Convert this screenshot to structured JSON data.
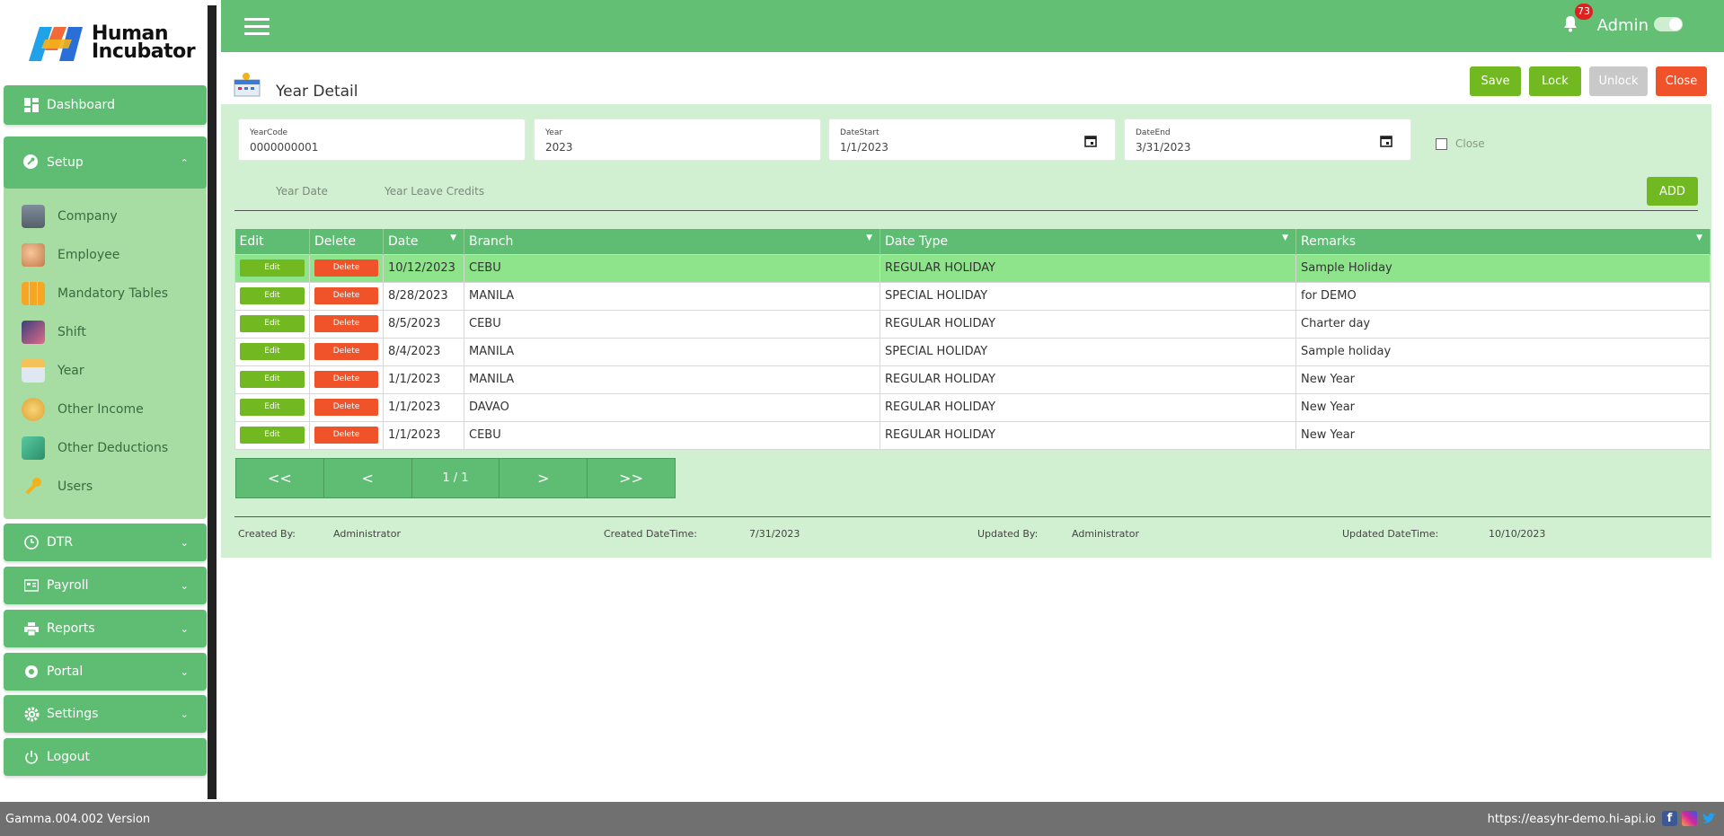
{
  "brand": {
    "name_line1": "Human",
    "name_line2": "Incubator"
  },
  "sidebar": {
    "dashboard": "Dashboard",
    "setup": "Setup",
    "setup_items": [
      "Company",
      "Employee",
      "Mandatory Tables",
      "Shift",
      "Year",
      "Other Income",
      "Other Deductions",
      "Users"
    ],
    "dtr": "DTR",
    "payroll": "Payroll",
    "reports": "Reports",
    "portal": "Portal",
    "settings": "Settings",
    "logout": "Logout"
  },
  "topbar": {
    "notification_count": "73",
    "user": "Admin"
  },
  "page": {
    "title": "Year Detail"
  },
  "actions": {
    "save": "Save",
    "lock": "Lock",
    "unlock": "Unlock",
    "close": "Close"
  },
  "form": {
    "year_code_label": "YearCode",
    "year_code": "0000000001",
    "year_label": "Year",
    "year": "2023",
    "date_start_label": "DateStart",
    "date_start": "1/1/2023",
    "date_end_label": "DateEnd",
    "date_end": "3/31/2023",
    "close_label": "Close"
  },
  "tabs": {
    "year_date": "Year Date",
    "year_leave_credits": "Year Leave Credits",
    "add": "ADD"
  },
  "table": {
    "headers": {
      "edit": "Edit",
      "delete": "Delete",
      "date": "Date",
      "branch": "Branch",
      "date_type": "Date Type",
      "remarks": "Remarks"
    },
    "edit_label": "Edit",
    "delete_label": "Delete",
    "rows": [
      {
        "date": "10/12/2023",
        "branch": "CEBU",
        "date_type": "REGULAR HOLIDAY",
        "remarks": "Sample Holiday"
      },
      {
        "date": "8/28/2023",
        "branch": "MANILA",
        "date_type": "SPECIAL HOLIDAY",
        "remarks": "for DEMO"
      },
      {
        "date": "8/5/2023",
        "branch": "CEBU",
        "date_type": "REGULAR HOLIDAY",
        "remarks": "Charter day"
      },
      {
        "date": "8/4/2023",
        "branch": "MANILA",
        "date_type": "SPECIAL HOLIDAY",
        "remarks": "Sample holiday"
      },
      {
        "date": "1/1/2023",
        "branch": "MANILA",
        "date_type": "REGULAR HOLIDAY",
        "remarks": "New Year"
      },
      {
        "date": "1/1/2023",
        "branch": "DAVAO",
        "date_type": "REGULAR HOLIDAY",
        "remarks": "New Year"
      },
      {
        "date": "1/1/2023",
        "branch": "CEBU",
        "date_type": "REGULAR HOLIDAY",
        "remarks": "New Year"
      }
    ]
  },
  "pager": {
    "first": "<<",
    "prev": "<",
    "info": "1 / 1",
    "next": ">",
    "last": ">>"
  },
  "meta": {
    "created_by_label": "Created By:",
    "created_by": "Administrator",
    "created_dt_label": "Created DateTime:",
    "created_dt": "7/31/2023",
    "updated_by_label": "Updated By:",
    "updated_by": "Administrator",
    "updated_dt_label": "Updated DateTime:",
    "updated_dt": "10/10/2023"
  },
  "footer": {
    "version": "Gamma.004.002 Version",
    "url": "https://easyhr-demo.hi-api.io"
  },
  "colors": {
    "primary_green": "#5fbd73",
    "action_green": "#72b821",
    "danger": "#f0532a",
    "panel_bg": "#d1efd1",
    "highlight_row": "#8ee48b"
  }
}
